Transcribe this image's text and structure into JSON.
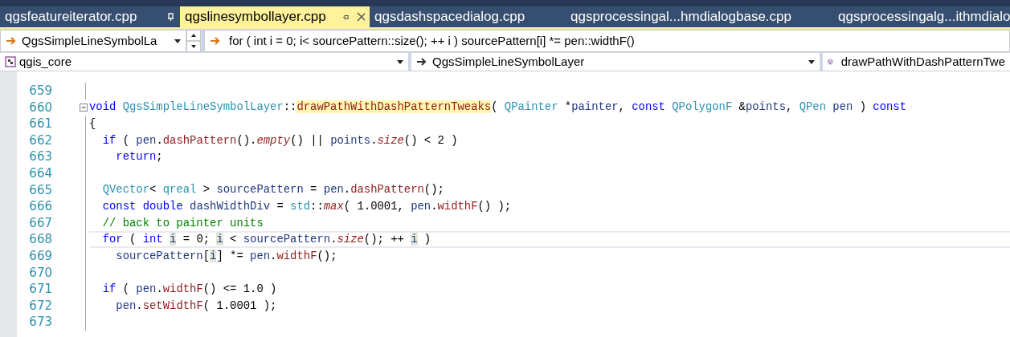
{
  "tabs": [
    {
      "label": "qgsfeatureiterator.cpp",
      "selected": false,
      "pinned": true
    },
    {
      "label": "qgslinesymbollayer.cpp",
      "selected": true,
      "pinned": true
    },
    {
      "label": "qgsdashspacedialog.cpp",
      "selected": false,
      "pinned": false
    },
    {
      "label": "qgsprocessingal...hmdialogbase.cpp",
      "selected": false,
      "pinned": false
    },
    {
      "label": "qgsprocessingalg...ithmdialo",
      "selected": false,
      "pinned": false
    }
  ],
  "navigation": {
    "scope": "QgsSimpleLineSymbolLa",
    "statement": "for ( int i = 0; i< sourcePattern::size(); ++ i ) sourcePattern[i] *= pen::widthF()"
  },
  "context": {
    "project": "qgis_core",
    "class": "QgsSimpleLineSymbolLayer",
    "member": "drawPathWithDashPatternTwe"
  },
  "editor": {
    "lines": [
      {
        "number": "659",
        "current": false,
        "fold": false
      },
      {
        "number": "660",
        "current": false,
        "fold": true,
        "tokens": [
          {
            "text": "void ",
            "kind": "keyword"
          },
          {
            "text": "QgsSimpleLineSymbolLayer",
            "kind": "type"
          },
          {
            "text": "::",
            "kind": "plain"
          },
          {
            "text": "drawPathWithDashPatternTweaks",
            "kind": "definition"
          },
          {
            "text": "( ",
            "kind": "plain"
          },
          {
            "text": "QPainter",
            "kind": "type"
          },
          {
            "text": " *",
            "kind": "plain"
          },
          {
            "text": "painter",
            "kind": "variable"
          },
          {
            "text": ", ",
            "kind": "plain"
          },
          {
            "text": "const ",
            "kind": "keyword"
          },
          {
            "text": "QPolygonF",
            "kind": "type"
          },
          {
            "text": " &",
            "kind": "plain"
          },
          {
            "text": "points",
            "kind": "variable"
          },
          {
            "text": ", ",
            "kind": "plain"
          },
          {
            "text": "QPen ",
            "kind": "type"
          },
          {
            "text": "pen",
            "kind": "variable"
          },
          {
            "text": " ) ",
            "kind": "plain"
          },
          {
            "text": "const",
            "kind": "keyword"
          }
        ]
      },
      {
        "number": "661",
        "current": false,
        "fold": false,
        "tokens": [
          {
            "text": "{",
            "kind": "plain"
          }
        ]
      },
      {
        "number": "662",
        "current": false,
        "fold": false,
        "tokens": [
          {
            "text": "  if",
            "kind": "keyword"
          },
          {
            "text": " ( ",
            "kind": "plain"
          },
          {
            "text": "pen",
            "kind": "variable"
          },
          {
            "text": ".",
            "kind": "plain"
          },
          {
            "text": "dashPattern",
            "kind": "function"
          },
          {
            "text": "().",
            "kind": "plain"
          },
          {
            "text": "empty",
            "kind": "italic"
          },
          {
            "text": "() || ",
            "kind": "plain"
          },
          {
            "text": "points",
            "kind": "variable"
          },
          {
            "text": ".",
            "kind": "plain"
          },
          {
            "text": "size",
            "kind": "italic"
          },
          {
            "text": "() < 2 )",
            "kind": "plain"
          }
        ]
      },
      {
        "number": "663",
        "current": false,
        "fold": false,
        "tokens": [
          {
            "text": "    return",
            "kind": "keyword"
          },
          {
            "text": ";",
            "kind": "plain"
          }
        ]
      },
      {
        "number": "664",
        "current": false,
        "fold": false
      },
      {
        "number": "665",
        "current": false,
        "fold": false,
        "tokens": [
          {
            "text": "  QVector",
            "kind": "type"
          },
          {
            "text": "< ",
            "kind": "plain"
          },
          {
            "text": "qreal",
            "kind": "type"
          },
          {
            "text": " > ",
            "kind": "plain"
          },
          {
            "text": "sourcePattern",
            "kind": "variable"
          },
          {
            "text": " = ",
            "kind": "plain"
          },
          {
            "text": "pen",
            "kind": "variable"
          },
          {
            "text": ".",
            "kind": "plain"
          },
          {
            "text": "dashPattern",
            "kind": "function"
          },
          {
            "text": "();",
            "kind": "plain"
          }
        ]
      },
      {
        "number": "666",
        "current": false,
        "fold": false,
        "tokens": [
          {
            "text": "  const double ",
            "kind": "keyword"
          },
          {
            "text": "dashWidthDiv",
            "kind": "variable"
          },
          {
            "text": " = ",
            "kind": "plain"
          },
          {
            "text": "std",
            "kind": "type"
          },
          {
            "text": "::",
            "kind": "plain"
          },
          {
            "text": "max",
            "kind": "italic"
          },
          {
            "text": "( 1.0001, ",
            "kind": "plain"
          },
          {
            "text": "pen",
            "kind": "variable"
          },
          {
            "text": ".",
            "kind": "plain"
          },
          {
            "text": "widthF",
            "kind": "function"
          },
          {
            "text": "() );",
            "kind": "plain"
          }
        ]
      },
      {
        "number": "667",
        "current": false,
        "fold": false,
        "tokens": [
          {
            "text": "  // back to painter units",
            "kind": "comment"
          }
        ]
      },
      {
        "number": "668",
        "current": true,
        "fold": false,
        "tokens": [
          {
            "text": "  for",
            "kind": "keyword"
          },
          {
            "text": " ( ",
            "kind": "plain"
          },
          {
            "text": "int ",
            "kind": "keyword"
          },
          {
            "text": "i",
            "kind": "reference"
          },
          {
            "text": " = 0; ",
            "kind": "plain"
          },
          {
            "text": "i",
            "kind": "reference"
          },
          {
            "text": " < ",
            "kind": "plain"
          },
          {
            "text": "sourcePattern",
            "kind": "variable"
          },
          {
            "text": ".",
            "kind": "plain"
          },
          {
            "text": "size",
            "kind": "italic"
          },
          {
            "text": "(); ++ ",
            "kind": "plain"
          },
          {
            "text": "i",
            "kind": "reference"
          },
          {
            "text": " )",
            "kind": "plain"
          }
        ]
      },
      {
        "number": "669",
        "current": false,
        "fold": false,
        "tokens": [
          {
            "text": "    sourcePattern",
            "kind": "variable"
          },
          {
            "text": "[",
            "kind": "plain"
          },
          {
            "text": "i",
            "kind": "reference"
          },
          {
            "text": "] *= ",
            "kind": "plain"
          },
          {
            "text": "pen",
            "kind": "variable"
          },
          {
            "text": ".",
            "kind": "plain"
          },
          {
            "text": "widthF",
            "kind": "function"
          },
          {
            "text": "();",
            "kind": "plain"
          }
        ]
      },
      {
        "number": "670",
        "current": false,
        "fold": false
      },
      {
        "number": "671",
        "current": false,
        "fold": false,
        "tokens": [
          {
            "text": "  if",
            "kind": "keyword"
          },
          {
            "text": " ( ",
            "kind": "plain"
          },
          {
            "text": "pen",
            "kind": "variable"
          },
          {
            "text": ".",
            "kind": "plain"
          },
          {
            "text": "widthF",
            "kind": "function"
          },
          {
            "text": "() <= 1.0 )",
            "kind": "plain"
          }
        ]
      },
      {
        "number": "672",
        "current": false,
        "fold": false,
        "tokens": [
          {
            "text": "    pen",
            "kind": "variable"
          },
          {
            "text": ".",
            "kind": "plain"
          },
          {
            "text": "setWidthF",
            "kind": "function"
          },
          {
            "text": "( 1.0001 );",
            "kind": "plain"
          }
        ]
      },
      {
        "number": "673",
        "current": false,
        "fold": false
      }
    ]
  }
}
